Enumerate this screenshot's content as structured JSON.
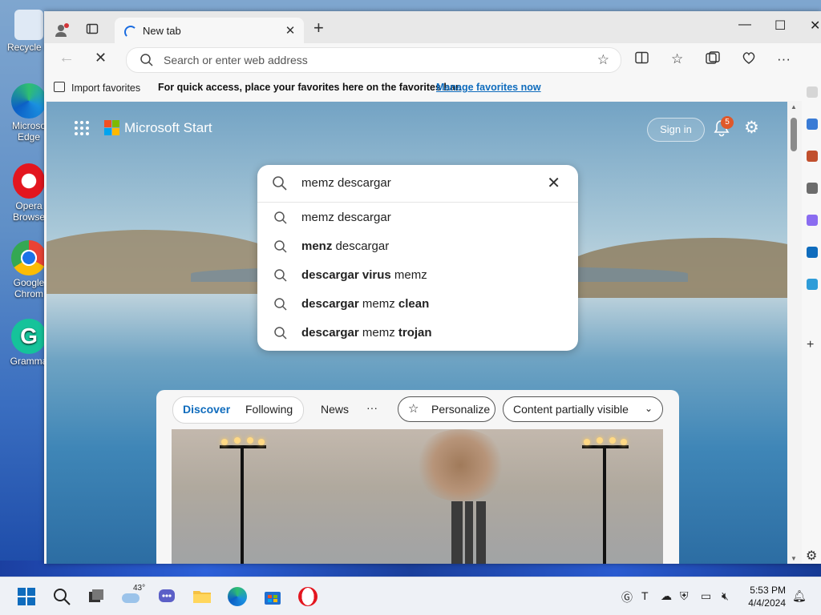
{
  "desktop": {
    "icons": [
      {
        "label": "Recycle B"
      },
      {
        "label": "Microso Edge"
      },
      {
        "label": "Opera Browse"
      },
      {
        "label": "Google Chrom"
      },
      {
        "label": "Gramma"
      }
    ]
  },
  "browser": {
    "tab_title": "New tab",
    "address_placeholder": "Search or enter web address",
    "favbar": {
      "import_label": "Import favorites",
      "message": "For quick access, place your favorites here on the favorites bar.",
      "manage_link": "Manage favorites now"
    }
  },
  "start_page": {
    "brand": "Microsoft Start",
    "sign_in": "Sign in",
    "notification_count": "5"
  },
  "search": {
    "query": "memz descargar",
    "suggestions": [
      {
        "bold": "",
        "plain": "memz descargar",
        "bold_after": ""
      },
      {
        "bold": "menz",
        "plain": " descargar",
        "bold_after": ""
      },
      {
        "bold": "descargar virus",
        "plain": " memz",
        "bold_after": ""
      },
      {
        "bold": "descargar",
        "plain": " memz ",
        "bold_after": "clean"
      },
      {
        "bold": "descargar",
        "plain": " memz ",
        "bold_after": "trojan"
      }
    ]
  },
  "feed": {
    "tabs": [
      "Discover",
      "Following"
    ],
    "news": "News",
    "more": "···",
    "personalize": "Personalize",
    "content_visibility": "Content partially visible"
  },
  "taskbar": {
    "weather_temp": "43°",
    "time": "5:53 PM",
    "date": "4/4/2024"
  },
  "colors": {
    "accent": "#0f6cbd",
    "badge": "#e0582a"
  }
}
